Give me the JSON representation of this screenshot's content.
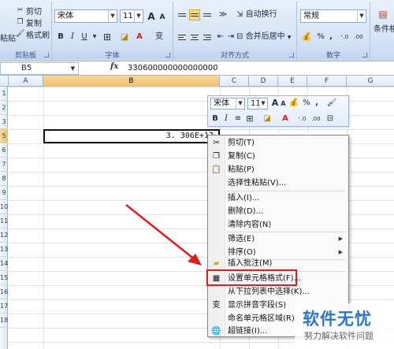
{
  "ribbon": {
    "clipboard": {
      "label": "剪贴板",
      "paste": "粘贴",
      "cut": "剪切",
      "copy": "复制",
      "format_painter": "格式刷"
    },
    "font": {
      "label": "字体",
      "font_name": "宋体",
      "font_size": "11",
      "grow": "A",
      "shrink": "A",
      "bold": "B",
      "italic": "I",
      "underline": "U",
      "wen": "变"
    },
    "alignment": {
      "label": "对齐方式",
      "wrap_text": "自动换行",
      "merge_center": "合并后居中"
    },
    "number": {
      "label": "数字",
      "format": "常规",
      "percent": "%",
      "comma": ","
    },
    "styles": {
      "conditional": "条件格"
    }
  },
  "formula_bar": {
    "name_box": "B5",
    "fx": "fx",
    "value": "330600000000000000"
  },
  "grid": {
    "columns": [
      "A",
      "B",
      "C",
      "D",
      "E",
      "F",
      "G"
    ],
    "rows": [
      "1",
      "2",
      "3",
      "4",
      "5",
      "6",
      "7",
      "8",
      "9",
      "10",
      "11",
      "12",
      "13",
      "14",
      "15",
      "16",
      "17",
      "18"
    ],
    "cell_b5": "3. 306E+17"
  },
  "mini_toolbar": {
    "font_name": "宋体",
    "font_size": "11",
    "bold": "B",
    "italic": "I",
    "percent": "%",
    "comma": ","
  },
  "context_menu": {
    "items": [
      {
        "label": "剪切(T)"
      },
      {
        "label": "复制(C)"
      },
      {
        "label": "粘贴(P)"
      },
      {
        "label": "选择性粘贴(V)..."
      },
      {
        "label": "插入(I)..."
      },
      {
        "label": "删除(D)..."
      },
      {
        "label": "清除内容(N)"
      },
      {
        "label": "筛选(E)"
      },
      {
        "label": "排序(O)"
      },
      {
        "label": "插入批注(M)"
      },
      {
        "label": "设置单元格格式(F)..."
      },
      {
        "label": "从下拉列表中选择(K)..."
      },
      {
        "label": "显示拼音字段(S)"
      },
      {
        "label": "命名单元格区域(R)..."
      },
      {
        "label": "超链接(I)..."
      }
    ]
  },
  "watermark": {
    "title": "软件无忧",
    "subtitle": "努力解决软件问题"
  },
  "colors": {
    "ribbon_bg": "#d6e4f6",
    "highlight_box": "#e21b1b",
    "arrow": "#e21b1b",
    "selected_header": "#f1be6a",
    "watermark_blue": "#2b77c9"
  }
}
